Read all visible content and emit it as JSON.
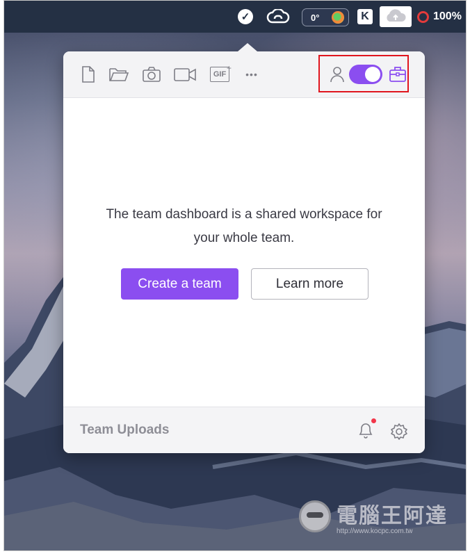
{
  "menubar": {
    "icons": [
      "checkmark-circle-icon",
      "creative-cloud-icon",
      "weather-widget-icon",
      "k-app-icon",
      "cloud-upload-icon",
      "battery-ring-icon"
    ],
    "temperature": "0°",
    "k_letter": "K",
    "battery": "100%"
  },
  "popup": {
    "toolbar": {
      "icons": [
        "document-icon",
        "folder-icon",
        "camera-icon",
        "video-camera-icon",
        "gif-icon",
        "more-icon"
      ],
      "gif_label": "GIF",
      "gif_plus": "+",
      "more_label": "•••",
      "toggle": {
        "state": "on",
        "left_icon": "person-icon",
        "right_icon": "briefcase-icon"
      }
    },
    "message": {
      "line1": "The team dashboard is a shared workspace for",
      "line2": "your whole team."
    },
    "buttons": {
      "create_team": "Create a team",
      "learn_more": "Learn more"
    },
    "footer": {
      "title": "Team Uploads",
      "notification_badge": true
    }
  },
  "watermark": {
    "text": "電腦王阿達",
    "url": "http://www.kocpc.com.tw"
  },
  "colors": {
    "accent": "#8b4ef0",
    "highlight_box": "#e0151e",
    "badge": "#f2364a",
    "menubar": "#243044"
  }
}
